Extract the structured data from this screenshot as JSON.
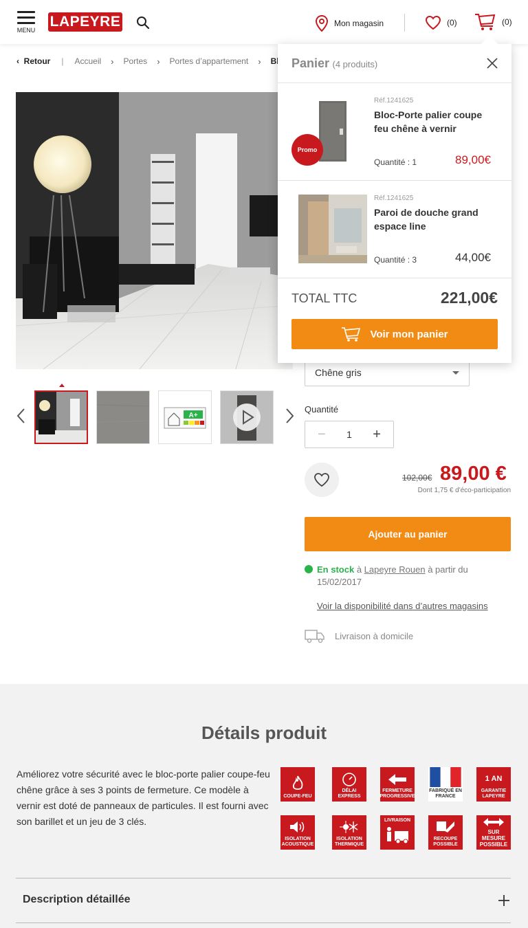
{
  "header": {
    "menu_label": "MENU",
    "logo_text": "LAPEYRE",
    "store_label": "Mon magasin",
    "favorites_count": "(0)",
    "cart_count": "(0)"
  },
  "breadcrumb": {
    "back": "Retour",
    "items": [
      "Accueil",
      "Portes",
      "Portes d’appartement",
      "Bloc"
    ]
  },
  "product": {
    "finish_selected": "Chêne gris",
    "quantity_label": "Quantité",
    "quantity_value": "1",
    "old_price": "102,00€",
    "price": "89,00 €",
    "eco_participation": "Dont 1,75 € d'éco-participation",
    "add_to_cart": "Ajouter au panier",
    "stock_status": "En stock",
    "stock_at": "à",
    "stock_store": "Lapeyre Rouen",
    "stock_from": "à partir du 15/02/2017",
    "availability_link": "Voir la disponibilité dans d’autres magasins",
    "delivery": "Livraison à domicile"
  },
  "cart_popup": {
    "title": "Panier",
    "count": "(4 produits)",
    "items": [
      {
        "promo": "Promo",
        "ref": "Réf.1241625",
        "name": "Bloc-Porte palier coupe feu chêne à vernir",
        "qty": "Quantité : 1",
        "price": "89,00€"
      },
      {
        "ref": "Réf.1241625",
        "name": "Paroi de douche grand espace line",
        "qty": "Quantité : 3",
        "price": "44,00€"
      }
    ],
    "total_label": "TOTAL TTC",
    "total_value": "221,00€",
    "button": "Voir mon panier"
  },
  "details": {
    "title": "Détails produit",
    "text": "Améliorez votre sécurité avec le bloc-porte palier coupe-feu chêne grâce à ses 3 points de fermeture. Ce modèle à vernir est doté de panneaux de particules. Il est fourni avec son barillet et un jeu de 3 clés.",
    "badges": {
      "coupe_feu": "COUPE-FEU",
      "delai_express": "DÉLAI EXPRESS",
      "fermeture": "FERMETURE PROGRESSIVE",
      "france": "FABRIQUÉ EN FRANCE",
      "garantie_top": "1 AN",
      "garantie": "GARANTIE LAPEYRE",
      "isolation_acoustique": "ISOLATION ACOUSTIQUE",
      "isolation_thermique": "ISOLATION THERMIQUE",
      "livraison": "LIVRAISON",
      "recoupe": "RECOUPE POSSIBLE",
      "sur_mesure": "SUR MESURE POSSIBLE"
    },
    "energy_label": "A+",
    "description_title": "Description détaillée"
  },
  "colors": {
    "brand_red": "#c8191f",
    "accent_orange": "#f28b14",
    "stock_green": "#2ab34a"
  }
}
